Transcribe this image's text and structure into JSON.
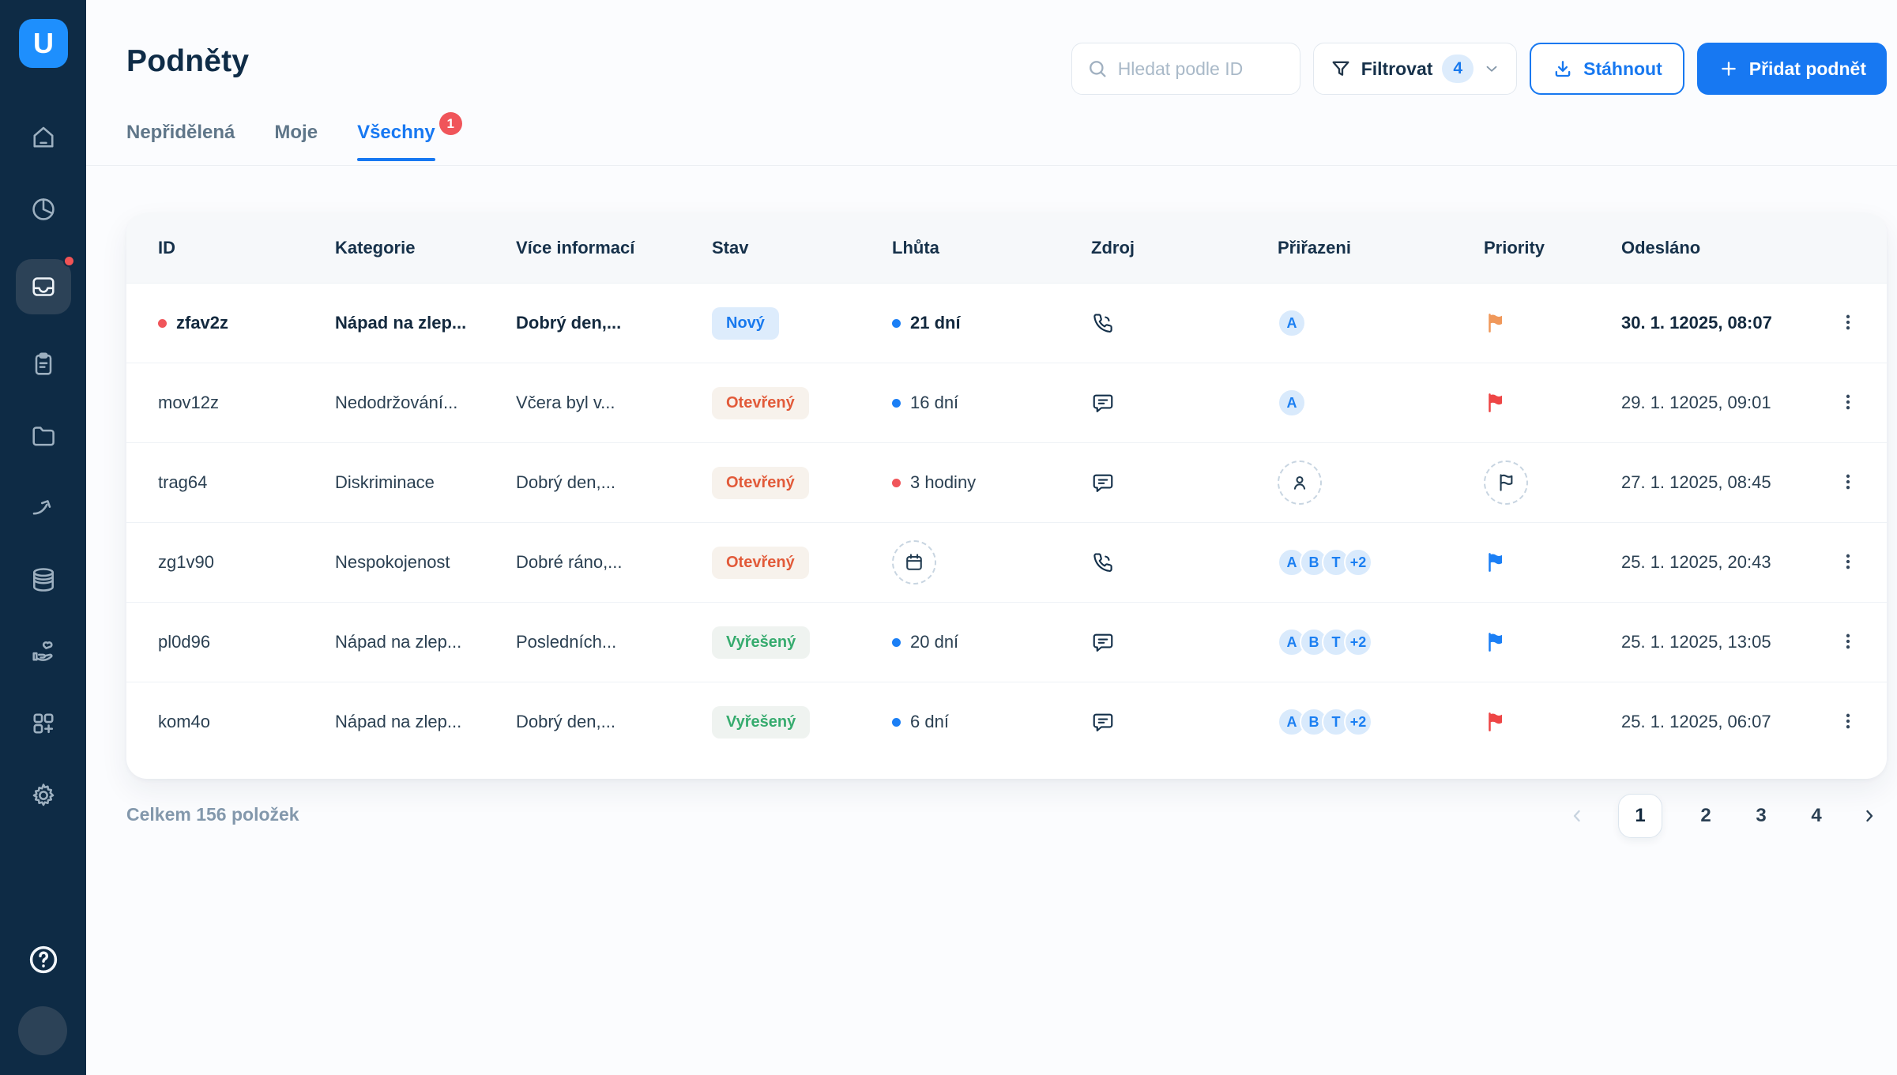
{
  "colors": {
    "sidebar_bg": "#0e2b45",
    "accent_blue": "#1778f2",
    "logo_blue": "#1e8ffd",
    "alert_red": "#f0555a",
    "status_new_text": "#1879ee",
    "status_new_bg": "#ddecfc",
    "status_open_text": "#e25a39",
    "status_open_bg": "#f7f2ec",
    "status_resolved_text": "#36ab6e",
    "status_resolved_bg": "#eff3f0",
    "flag_orange": "#f0985a",
    "flag_red": "#ee4545",
    "flag_blue": "#1b7ff5"
  },
  "brand": {
    "logo_letter": "U"
  },
  "sidebar": {
    "items": [
      "home",
      "analytics",
      "inbox",
      "tasks",
      "folder",
      "forward",
      "database",
      "care",
      "apps-add",
      "settings"
    ],
    "active_item": "inbox"
  },
  "header": {
    "title": "Podněty",
    "search_placeholder": "Hledat podle ID",
    "filter_label": "Filtrovat",
    "filter_count": "4",
    "download_label": "Stáhnout",
    "add_label": "Přidat podnět"
  },
  "tabs": [
    {
      "label": "Nepřidělená"
    },
    {
      "label": "Moje"
    },
    {
      "label": "Všechny",
      "badge": "1",
      "active": true
    }
  ],
  "table": {
    "columns": [
      "ID",
      "Kategorie",
      "Více informací",
      "Stav",
      "Lhůta",
      "Zdroj",
      "Přiřazeni",
      "Priority",
      "Odesláno"
    ],
    "rows": [
      {
        "id": "zfav2z",
        "unread": true,
        "category": "Nápad na zlep...",
        "info": "Dobrý den,...",
        "status": "Nový",
        "deadline": "21 dní",
        "deadline_dot": "blue",
        "source": "phone",
        "assignees": [
          "A"
        ],
        "priority": "orange",
        "sent": "30. 1. 12025, 08:07"
      },
      {
        "id": "mov12z",
        "unread": false,
        "category": "Nedodržování...",
        "info": "Včera byl v...",
        "status": "Otevřený",
        "deadline": "16 dní",
        "deadline_dot": "blue",
        "source": "chat",
        "assignees": [
          "A"
        ],
        "priority": "red",
        "sent": "29. 1. 12025, 09:01"
      },
      {
        "id": "trag64",
        "unread": false,
        "category": "Diskriminace",
        "info": "Dobrý den,...",
        "status": "Otevřený",
        "deadline": "3 hodiny",
        "deadline_dot": "red",
        "source": "chat",
        "assignees": [],
        "priority": "none",
        "sent": "27. 1. 12025, 08:45"
      },
      {
        "id": "zg1v90",
        "unread": false,
        "category": "Nespokojenost",
        "info": "Dobré ráno,...",
        "status": "Otevřený",
        "deadline": "",
        "deadline_dot": "none",
        "source": "phone",
        "assignees": [
          "A",
          "B",
          "T",
          "+2"
        ],
        "priority": "blue",
        "sent": "25. 1. 12025, 20:43"
      },
      {
        "id": "pl0d96",
        "unread": false,
        "category": "Nápad na zlep...",
        "info": "Posledních...",
        "status": "Vyřešený",
        "deadline": "20 dní",
        "deadline_dot": "blue",
        "source": "chat",
        "assignees": [
          "A",
          "B",
          "T",
          "+2"
        ],
        "priority": "blue",
        "sent": "25. 1. 12025, 13:05"
      },
      {
        "id": "kom4o",
        "unread": false,
        "category": "Nápad na zlep...",
        "info": "Dobrý den,...",
        "status": "Vyřešený",
        "deadline": "6 dní",
        "deadline_dot": "blue",
        "source": "chat",
        "assignees": [
          "A",
          "B",
          "T",
          "+2"
        ],
        "priority": "red",
        "sent": "25. 1. 12025, 06:07"
      }
    ]
  },
  "footer": {
    "total": "Celkem 156 položek",
    "pages": [
      "1",
      "2",
      "3",
      "4"
    ],
    "active_page": "1"
  }
}
